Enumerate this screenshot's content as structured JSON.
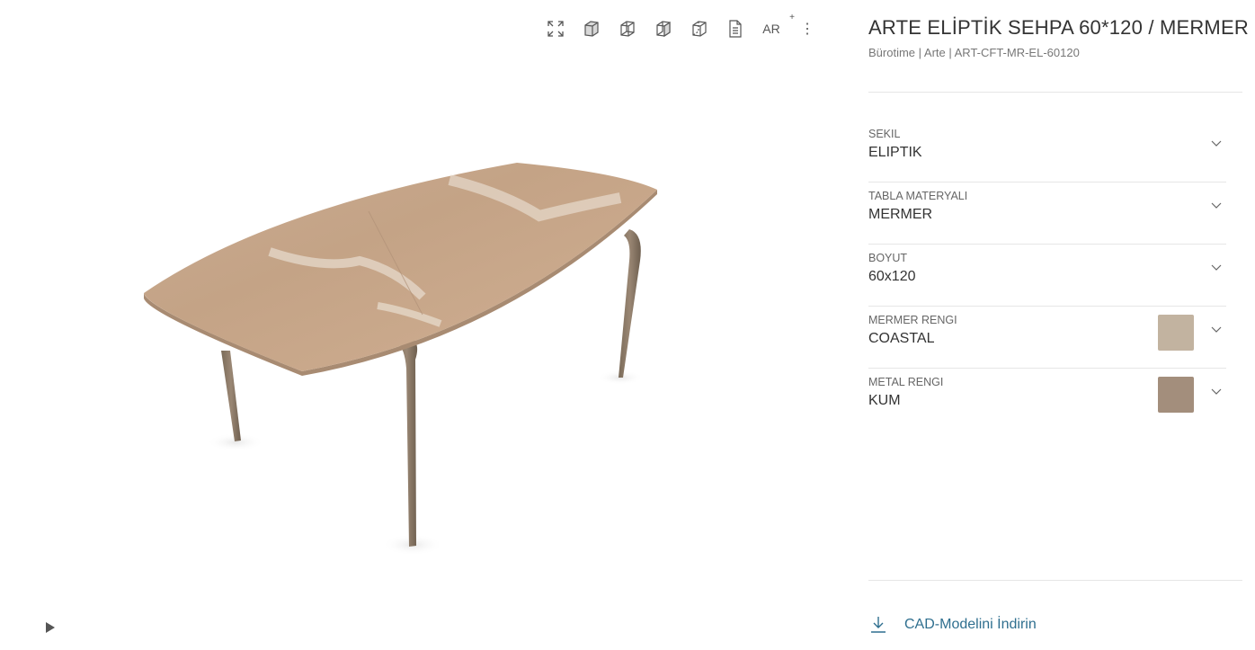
{
  "viewer": {
    "toolbar": [
      {
        "name": "fullscreen-icon"
      },
      {
        "name": "cube-solid-icon"
      },
      {
        "name": "cube-wireframe-icon"
      },
      {
        "name": "cube-half-icon"
      },
      {
        "name": "cube-outline-icon"
      },
      {
        "name": "document-icon"
      }
    ],
    "ar_label": "AR",
    "ar_plus": "+",
    "more_icon": "⋮"
  },
  "product": {
    "title": "ARTE ELİPTİK SEHPA 60*120 / MERMER",
    "subtitle": "Bürotime | Arte | ART-CFT-MR-EL-60120"
  },
  "options": [
    {
      "label": "SEKIL",
      "value": "ELIPTIK"
    },
    {
      "label": "TABLA MATERYALI",
      "value": "MERMER"
    },
    {
      "label": "BOYUT",
      "value": "60x120"
    },
    {
      "label": "MERMER RENGI",
      "value": "COASTAL",
      "swatch": "#c2b3a0"
    },
    {
      "label": "METAL RENGI",
      "value": "KUM",
      "swatch": "#a38e7c"
    }
  ],
  "cad": {
    "label": "CAD-Modelini İndirin"
  },
  "colors": {
    "accent": "#2f6f8f",
    "marble": "#c6a88c",
    "metal": "#8a7a68"
  }
}
